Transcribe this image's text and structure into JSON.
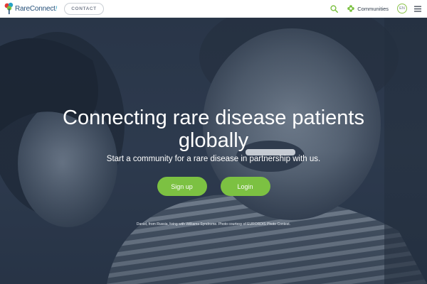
{
  "header": {
    "logo": {
      "brand": "RareConnect",
      "mark": "!"
    },
    "contact_label": "CONTACT",
    "communities_label": "Communities",
    "language": "EN",
    "icons": {
      "search": "search-icon",
      "communities": "flower-icon",
      "menu": "hamburger-menu-icon"
    }
  },
  "hero": {
    "title": "Connecting rare disease patients globally",
    "subtitle": "Start a community for a rare disease in partnership with us.",
    "signup_label": "Sign up",
    "login_label": "Login",
    "caption": "Daniel, from Russia, living with Williams Syndrome. Photo courtesy of EURORDIS Photo Contest."
  },
  "colors": {
    "accent_green": "#7cc142",
    "brand_blue": "#27517a",
    "hero_overlay": "#2b3a4e",
    "header_bg": "#ffffff"
  }
}
